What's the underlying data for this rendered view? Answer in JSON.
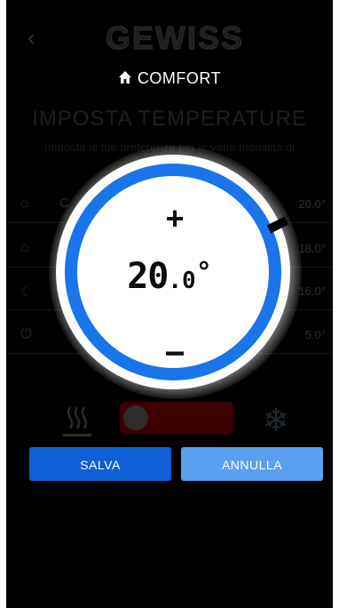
{
  "header": {
    "mode_icon": "home-icon",
    "mode_label": "COMFORT",
    "back_icon": "chevron-left-icon",
    "logo_text": "GEWISS"
  },
  "background": {
    "title": "IMPOSTA TEMPERATURE",
    "subtitle": "Imposta le tue preferenze per le varie modalità di",
    "rows": [
      {
        "icon": "home-icon",
        "name": "C",
        "value": "20.0°"
      },
      {
        "icon": "home-outline-icon",
        "name": "",
        "value": "18.0°"
      },
      {
        "icon": "moon-icon",
        "name": "",
        "value": "16.0°"
      },
      {
        "icon": "power-icon",
        "name": "",
        "value": "5.0°"
      }
    ]
  },
  "dial": {
    "increment_label": "+",
    "decrement_label": "−",
    "temperature_int": "20",
    "temperature_dec": ".0",
    "degree_symbol": "°",
    "ring_color": "#1a74ea",
    "indicator_color": "#000000"
  },
  "buttons": {
    "save_label": "SALVA",
    "cancel_label": "ANNULLA",
    "save_color": "#0f5fd6",
    "cancel_color": "#5aa0f0"
  },
  "mode_selector": {
    "heat_icon": "heat-icon",
    "cool_icon": "snowflake-icon"
  }
}
